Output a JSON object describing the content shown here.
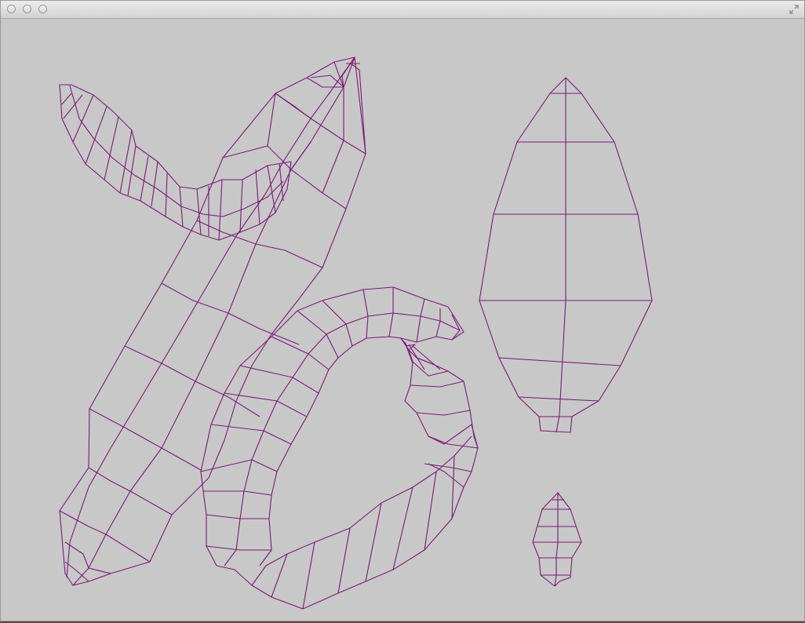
{
  "window": {
    "title": "",
    "buttons": [
      "close-button",
      "minimize-button",
      "zoom-button"
    ],
    "fullscreen_icon": "fullscreen-arrows-icon"
  },
  "canvas": {
    "background_color": "#c8c8c8",
    "wire_color": "#7a1a78",
    "content": "uv-wireframe-layout",
    "islands": [
      "body-island",
      "arm-island",
      "tail-island",
      "large-leaf-island",
      "small-leaf-island"
    ]
  }
}
